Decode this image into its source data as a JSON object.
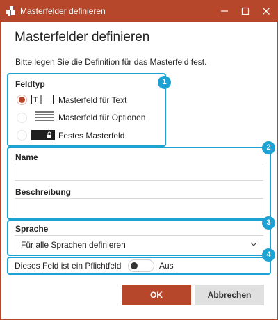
{
  "window": {
    "title": "Masterfelder definieren",
    "accent": "#b7472a"
  },
  "dialog": {
    "heading": "Masterfelder definieren",
    "intro": "Bitte legen Sie die Definition für das Masterfeld fest."
  },
  "callouts": [
    "1",
    "2",
    "3",
    "4"
  ],
  "feldtyp": {
    "label": "Feldtyp",
    "options": [
      {
        "label": "Masterfeld für Text",
        "icon": "text-field-icon",
        "selected": true
      },
      {
        "label": "Masterfeld für Optionen",
        "icon": "options-list-icon",
        "selected": false
      },
      {
        "label": "Festes Masterfeld",
        "icon": "locked-field-icon",
        "selected": false
      }
    ]
  },
  "name": {
    "label": "Name",
    "value": ""
  },
  "beschreibung": {
    "label": "Beschreibung",
    "value": ""
  },
  "sprache": {
    "label": "Sprache",
    "value": "Für alle Sprachen definieren"
  },
  "pflichtfeld": {
    "label": "Dieses Feld ist ein Pflichtfeld",
    "state": "Aus",
    "on": false
  },
  "buttons": {
    "ok": "OK",
    "cancel": "Abbrechen"
  }
}
